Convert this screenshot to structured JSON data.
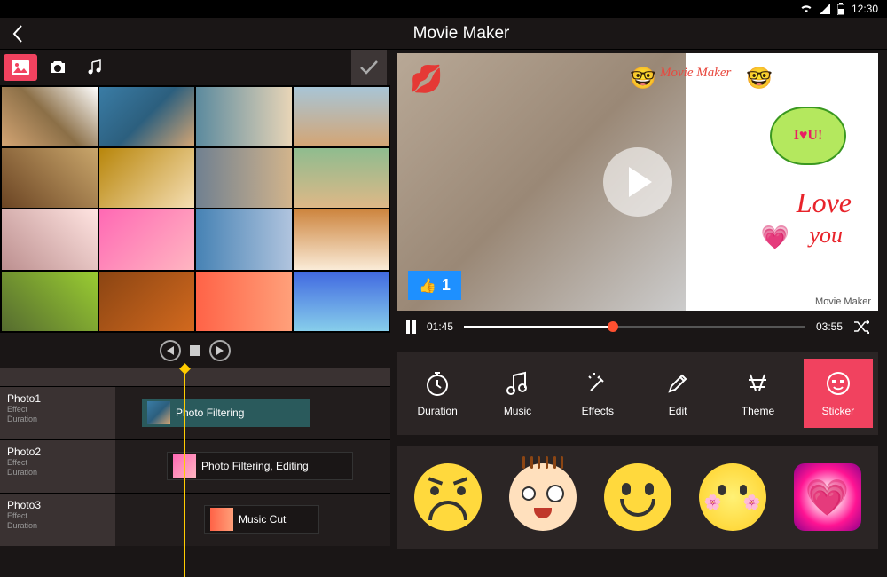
{
  "status": {
    "time": "12:30"
  },
  "header": {
    "title": "Movie Maker"
  },
  "tabs": {
    "photo": "photo",
    "camera": "camera",
    "music": "music"
  },
  "gallery": {
    "count": 16
  },
  "timeline": {
    "rows": [
      {
        "name": "Photo1",
        "effect": "Effect",
        "duration": "Duration",
        "clip": "Photo Filtering"
      },
      {
        "name": "Photo2",
        "effect": "Effect",
        "duration": "Duration",
        "clip": "Photo Filtering, Editing"
      },
      {
        "name": "Photo3",
        "effect": "Effect",
        "duration": "Duration",
        "clip": "Music Cut"
      }
    ]
  },
  "preview": {
    "like_count": "1",
    "mm_text": "Movie Maker",
    "iloveu": "I♥U!",
    "love": "Love",
    "you": "you",
    "watermark": "Movie Maker"
  },
  "player": {
    "current": "01:45",
    "total": "03:55",
    "progress_pct": 42
  },
  "tools": [
    {
      "label": "Duration"
    },
    {
      "label": "Music"
    },
    {
      "label": "Effects"
    },
    {
      "label": "Edit"
    },
    {
      "label": "Theme"
    },
    {
      "label": "Sticker"
    }
  ],
  "active_tool": "Sticker"
}
